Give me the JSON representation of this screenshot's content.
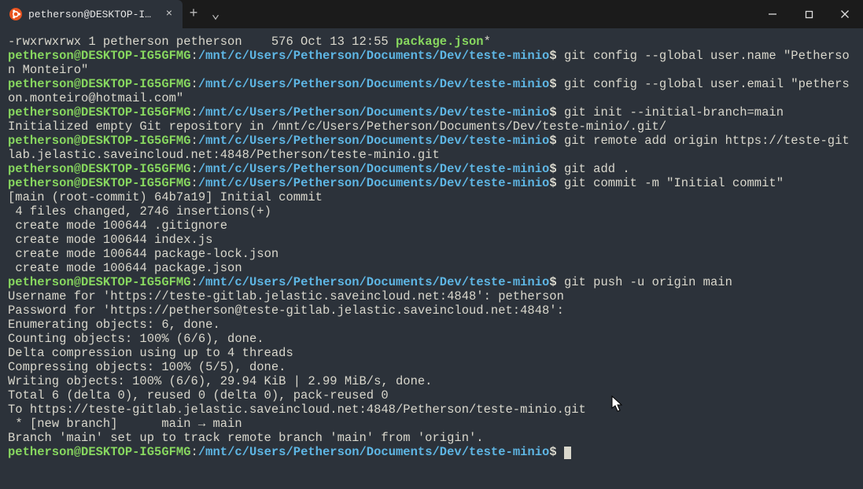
{
  "titlebar": {
    "tab_title": "petherson@DESKTOP-IG5GFM",
    "tab_close": "×",
    "new_tab": "+",
    "dropdown": "⌄"
  },
  "prompt": {
    "user": "petherson@DESKTOP-IG5GFMG",
    "colon": ":",
    "path": "/mnt/c/Users/Petherson/Documents/Dev/teste-minio",
    "sigil": "$"
  },
  "lines": {
    "ls_perm": "-rwxrwxrwx 1 petherson petherson    576 Oct 13 12:55 ",
    "ls_file": "package.json",
    "ls_suffix": "*",
    "cmd1": " git config --global user.name \"Petherson Monteiro\"",
    "cmd2": " git config --global user.email \"petherson.monteiro@hotmail.com\"",
    "cmd3": " git init --initial-branch=main",
    "out3": "Initialized empty Git repository in /mnt/c/Users/Petherson/Documents/Dev/teste-minio/.git/",
    "cmd4": " git remote add origin https://teste-gitlab.jelastic.saveincloud.net:4848/Petherson/teste-minio.git",
    "cmd5": " git add .",
    "cmd6": " git commit -m \"Initial commit\"",
    "commit_l1": "[main (root-commit) 64b7a19] Initial commit",
    "commit_l2": " 4 files changed, 2746 insertions(+)",
    "commit_l3": " create mode 100644 .gitignore",
    "commit_l4": " create mode 100644 index.js",
    "commit_l5": " create mode 100644 package-lock.json",
    "commit_l6": " create mode 100644 package.json",
    "cmd7": " git push -u origin main",
    "push_l1": "Username for 'https://teste-gitlab.jelastic.saveincloud.net:4848': petherson",
    "push_l2": "Password for 'https://petherson@teste-gitlab.jelastic.saveincloud.net:4848':",
    "push_l3": "Enumerating objects: 6, done.",
    "push_l4": "Counting objects: 100% (6/6), done.",
    "push_l5": "Delta compression using up to 4 threads",
    "push_l6": "Compressing objects: 100% (5/5), done.",
    "push_l7": "Writing objects: 100% (6/6), 29.94 KiB | 2.99 MiB/s, done.",
    "push_l8": "Total 6 (delta 0), reused 0 (delta 0), pack-reused 0",
    "push_l9": "To https://teste-gitlab.jelastic.saveincloud.net:4848/Petherson/teste-minio.git",
    "push_l10": " * [new branch]      main → main",
    "push_l11": "Branch 'main' set up to track remote branch 'main' from 'origin'.",
    "final_space": " "
  }
}
